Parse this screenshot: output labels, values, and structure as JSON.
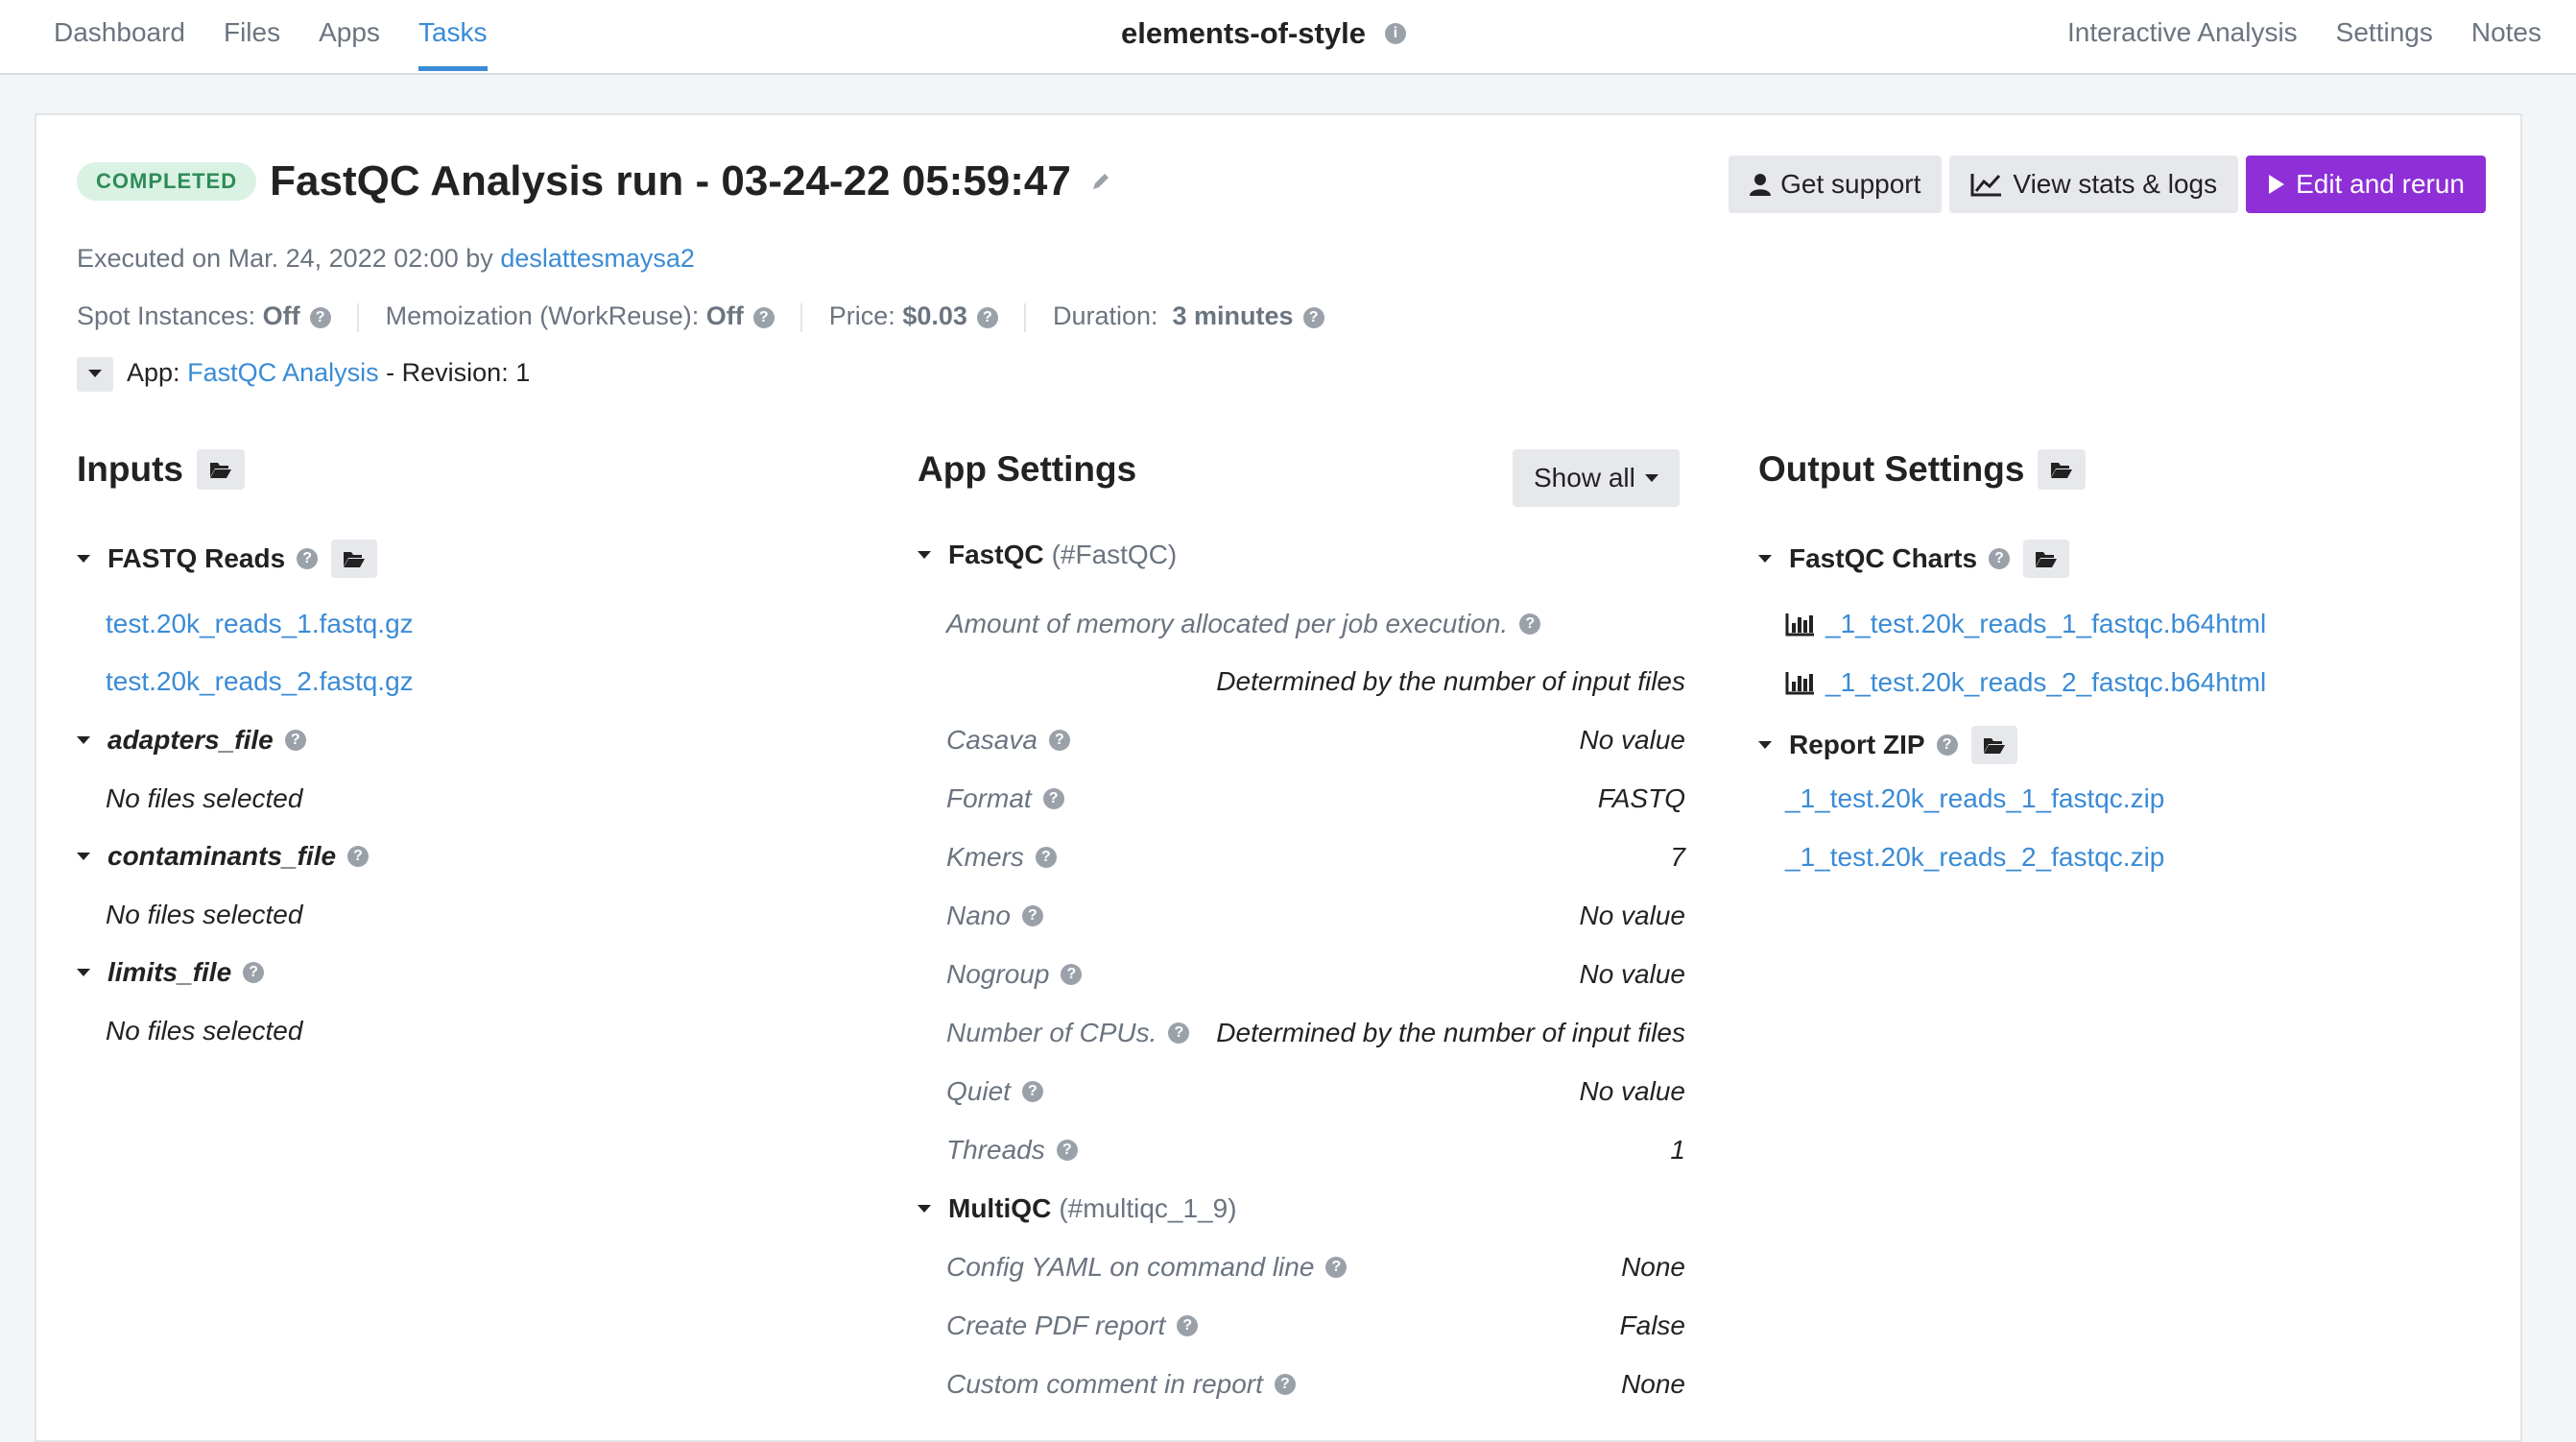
{
  "nav": {
    "left": [
      "Dashboard",
      "Files",
      "Apps",
      "Tasks"
    ],
    "active": "Tasks",
    "project": "elements-of-style",
    "right": [
      "Interactive Analysis",
      "Settings",
      "Notes"
    ]
  },
  "header": {
    "status": "COMPLETED",
    "title": "FastQC Analysis run - 03-24-22 05:59:47",
    "buttons": {
      "support": "Get support",
      "stats": "View stats & logs",
      "rerun": "Edit and rerun"
    }
  },
  "meta": {
    "executed_prefix": "Executed on Mar. 24, 2022 02:00 by",
    "user": "deslattesmaysa2",
    "spot_label": "Spot Instances:",
    "spot_value": "Off",
    "memo_label": "Memoization (WorkReuse):",
    "memo_value": "Off",
    "price_label": "Price:",
    "price_value": "$0.03",
    "duration_label": "Duration:",
    "duration_value": "3 minutes",
    "app_label": "App:",
    "app_name": "FastQC Analysis",
    "revision": "- Revision: 1"
  },
  "inputs": {
    "title": "Inputs",
    "groups": [
      {
        "label": "FASTQ Reads",
        "items": [
          "test.20k_reads_1.fastq.gz",
          "test.20k_reads_2.fastq.gz"
        ]
      },
      {
        "label": "adapters_file",
        "items": [
          "No files selected"
        ]
      },
      {
        "label": "contaminants_file",
        "items": [
          "No files selected"
        ]
      },
      {
        "label": "limits_file",
        "items": [
          "No files selected"
        ]
      }
    ]
  },
  "settings": {
    "title": "App Settings",
    "show_all": "Show all",
    "fastqc_name": "FastQC",
    "fastqc_id": "(#FastQC)",
    "memory_label": "Amount of memory allocated per job execution.",
    "memory_value": "Determined by the number of input files",
    "rows": [
      {
        "label": "Casava",
        "value": "No value"
      },
      {
        "label": "Format",
        "value": "FASTQ"
      },
      {
        "label": "Kmers",
        "value": "7"
      },
      {
        "label": "Nano",
        "value": "No value"
      },
      {
        "label": "Nogroup",
        "value": "No value"
      },
      {
        "label": "Number of CPUs.",
        "value": "Determined by the number of input files"
      },
      {
        "label": "Quiet",
        "value": "No value"
      },
      {
        "label": "Threads",
        "value": "1"
      }
    ],
    "multiqc_name": "MultiQC",
    "multiqc_id": "(#multiqc_1_9)",
    "multiqc_rows": [
      {
        "label": "Config YAML on command line",
        "value": "None"
      },
      {
        "label": "Create PDF report",
        "value": "False"
      },
      {
        "label": "Custom comment in report",
        "value": "None"
      }
    ]
  },
  "outputs": {
    "title": "Output Settings",
    "charts_label": "FastQC Charts",
    "charts": [
      "_1_test.20k_reads_1_fastqc.b64html",
      "_1_test.20k_reads_2_fastqc.b64html"
    ],
    "zip_label": "Report ZIP",
    "zips": [
      "_1_test.20k_reads_1_fastqc.zip",
      "_1_test.20k_reads_2_fastqc.zip"
    ]
  }
}
